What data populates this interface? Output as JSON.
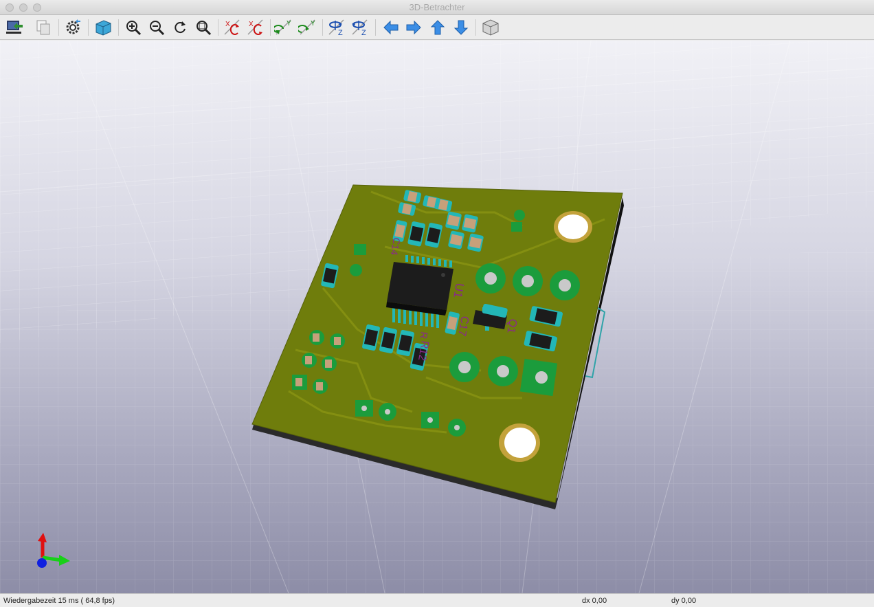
{
  "window": {
    "title": "3D-Betrachter"
  },
  "toolbar": {
    "tools": [
      "reload-board-icon",
      "copy-image-icon",
      "settings-icon",
      "raytracing-icon",
      "zoom-in-icon",
      "zoom-out-icon",
      "redraw-icon",
      "zoom-fit-icon",
      "rotate-x-cw-icon",
      "rotate-x-ccw-icon",
      "rotate-y-cw-icon",
      "rotate-y-ccw-icon",
      "rotate-z-cw-icon",
      "rotate-z-ccw-icon",
      "pan-left-icon",
      "pan-right-icon",
      "pan-up-icon",
      "pan-down-icon",
      "orthographic-icon"
    ],
    "axis_labels": {
      "x": "X",
      "y": "Y",
      "z": "Z"
    }
  },
  "board": {
    "references": [
      "U1",
      "C17",
      "Q1",
      "R12",
      "C14",
      "R"
    ],
    "colors": {
      "soldermask": "#6f7d0c",
      "copper_pad": "#1b9c3c",
      "edge": "#1c1c1c",
      "smd_pad": "#23b7b7"
    }
  },
  "status": {
    "render_time": "Wiedergabezeit 15 ms ( 64,8 fps)",
    "dx": "dx 0,00",
    "dy": "dy 0,00"
  }
}
